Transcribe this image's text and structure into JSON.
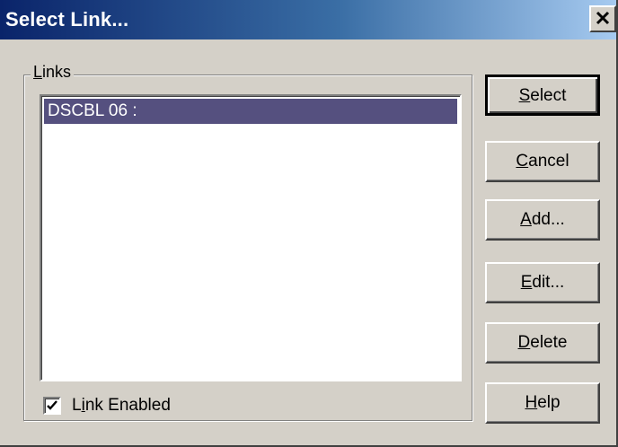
{
  "window": {
    "title": "Select Link...",
    "close_glyph": "✕"
  },
  "links_group": {
    "label_prefix": "",
    "label_underlined": "L",
    "label_rest": "inks",
    "items": [
      "DSCBL 06 :"
    ]
  },
  "checkbox": {
    "checked": true,
    "label_prefix": "L",
    "label_underlined": "i",
    "label_rest": "nk Enabled"
  },
  "buttons": [
    {
      "prefix": "",
      "underlined": "S",
      "rest": "elect"
    },
    {
      "prefix": "",
      "underlined": "C",
      "rest": "ancel"
    },
    {
      "prefix": "",
      "underlined": "A",
      "rest": "dd..."
    },
    {
      "prefix": "",
      "underlined": "E",
      "rest": "dit..."
    },
    {
      "prefix": "",
      "underlined": "D",
      "rest": "elete"
    },
    {
      "prefix": "",
      "underlined": "H",
      "rest": "elp"
    }
  ],
  "colors": {
    "title_bar_start": "#0a246a",
    "title_bar_end": "#a6caf0",
    "selection": "#55507f",
    "face": "#d4d0c8"
  }
}
